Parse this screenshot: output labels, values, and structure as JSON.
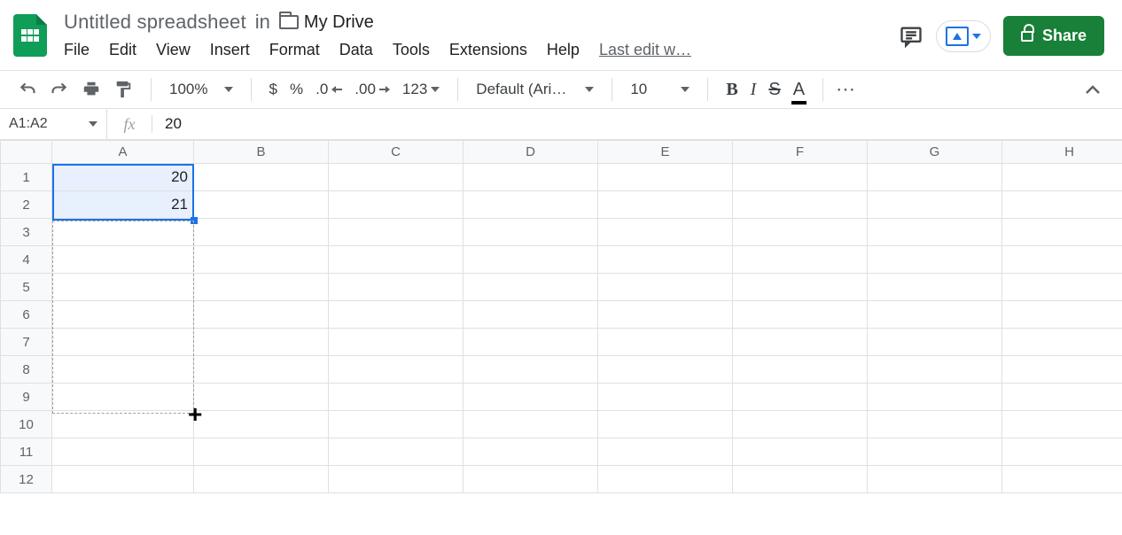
{
  "header": {
    "docname": "Untitled spreadsheet",
    "in_label": "in",
    "folder": "My Drive",
    "menus": [
      "File",
      "Edit",
      "View",
      "Insert",
      "Format",
      "Data",
      "Tools",
      "Extensions",
      "Help"
    ],
    "last_edit": "Last edit w…",
    "share_label": "Share"
  },
  "toolbar": {
    "zoom": "100%",
    "currency": "$",
    "percent": "%",
    "dec_dec": ".0",
    "inc_dec": ".00",
    "more_formats": "123",
    "font": "Default (Ari…",
    "font_size": "10",
    "bold": "B",
    "italic": "I",
    "strike": "S",
    "textcolor": "A",
    "more": "⋯"
  },
  "namebox": "A1:A2",
  "fx_label": "fx",
  "formula_value": "20",
  "columns": [
    "A",
    "B",
    "C",
    "D",
    "E",
    "F",
    "G",
    "H"
  ],
  "rows": [
    "1",
    "2",
    "3",
    "4",
    "5",
    "6",
    "7",
    "8",
    "9",
    "10",
    "11",
    "12"
  ],
  "cells": {
    "A1": "20",
    "A2": "21"
  },
  "chart_data": {
    "type": "table",
    "columns": [
      "A"
    ],
    "rows": [
      [
        20
      ],
      [
        21
      ]
    ]
  }
}
